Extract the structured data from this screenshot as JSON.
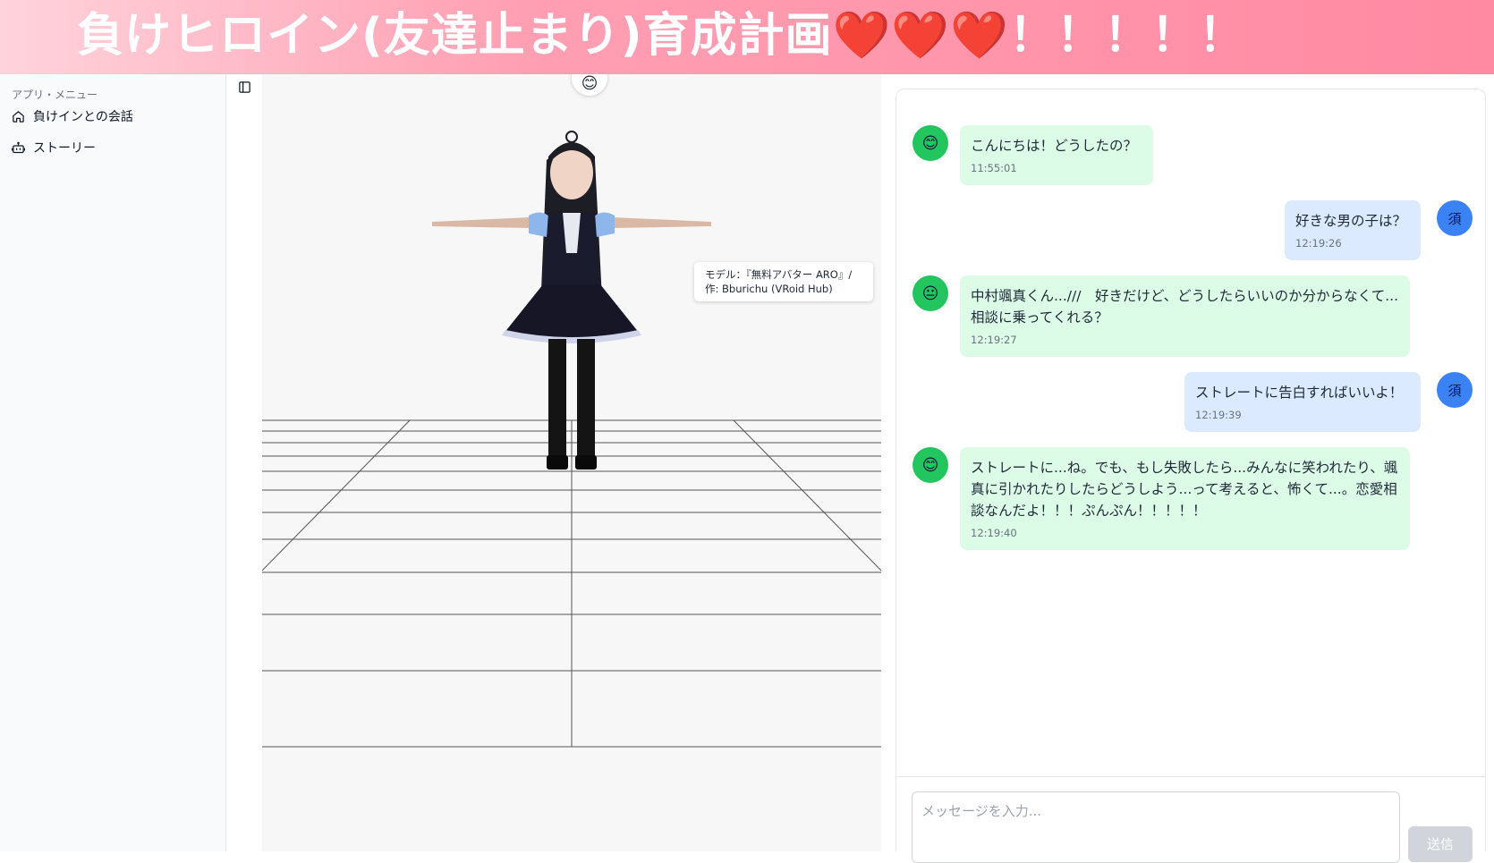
{
  "banner": {
    "title": "負けヒロイン(友達止まり)育成計画",
    "hearts": "❤️❤️❤️",
    "exclaim": "！！！！！"
  },
  "sidebar": {
    "section_label": "アプリ・メニュー",
    "items": [
      {
        "label": "負けインとの会話",
        "icon": "home-icon"
      },
      {
        "label": "ストーリー",
        "icon": "bot-icon"
      }
    ]
  },
  "viewer": {
    "emote": "😊",
    "credit_line1": "モデル：『無料アバター ARO』/",
    "credit_line2": "作: Bburichu (VRoid Hub)"
  },
  "chat": {
    "messages": [
      {
        "role": "bot",
        "avatar": "😊",
        "text": "こんにちは！どうしたの？",
        "time": "11:55:01"
      },
      {
        "role": "user",
        "avatar": "須",
        "text": "好きな男の子は？",
        "time": "12:19:26"
      },
      {
        "role": "bot",
        "avatar": "😐",
        "text": "中村颯真くん...///　好きだけど、どうしたらいいのか分からなくて...  相談に乗ってくれる？",
        "time": "12:19:27"
      },
      {
        "role": "user",
        "avatar": "須",
        "text": "ストレートに告白すればいいよ！",
        "time": "12:19:39"
      },
      {
        "role": "bot",
        "avatar": "😊",
        "text": "ストレートに...ね。でも、もし失敗したら...みんなに笑われたり、颯真に引かれたりしたらどうしよう...って考えると、怖くて...。恋愛相談なんだよ！！！ぷんぷん！！！！！",
        "time": "12:19:40"
      }
    ],
    "input_placeholder": "メッセージを入力...",
    "send_label": "送信"
  },
  "colors": {
    "bot_bubble": "#dcfce7",
    "user_bubble": "#dbeafe",
    "bot_avatar": "#22c55e",
    "user_avatar": "#3b82f6",
    "banner_accent": "#ff8aa2"
  }
}
